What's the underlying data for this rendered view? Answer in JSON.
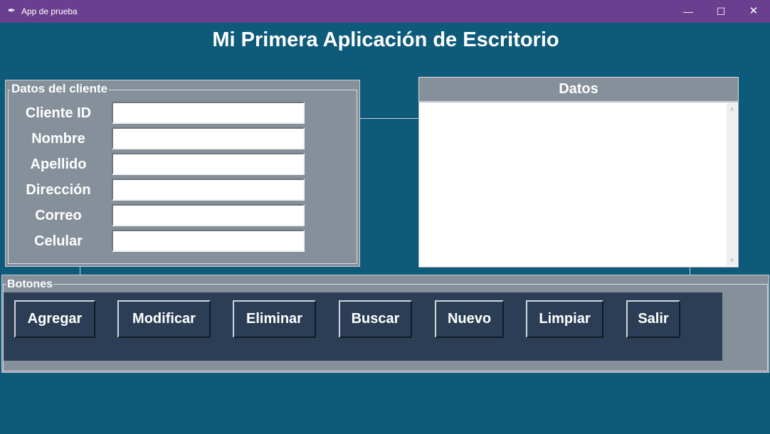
{
  "window": {
    "title": "App de prueba",
    "icon": "feather-icon",
    "controls": {
      "minimize": "—",
      "maximize": "☐",
      "close": "✕"
    }
  },
  "app": {
    "heading": "Mi Primera Aplicación de Escritorio",
    "cliente": {
      "legend": "Datos del cliente",
      "fields": [
        {
          "label": "Cliente ID",
          "value": ""
        },
        {
          "label": "Nombre",
          "value": ""
        },
        {
          "label": "Apellido",
          "value": ""
        },
        {
          "label": "Dirección",
          "value": ""
        },
        {
          "label": "Correo",
          "value": ""
        },
        {
          "label": "Celular",
          "value": ""
        }
      ]
    },
    "datos": {
      "title": "Datos",
      "content": ""
    },
    "botones": {
      "legend": "Botones",
      "buttons": [
        "Agregar",
        "Modificar",
        "Eliminar",
        "Buscar",
        "Nuevo",
        "Limpiar",
        "Salir"
      ]
    }
  },
  "colors": {
    "titlebar": "#6b3f8f",
    "background": "#0e5a7a",
    "frame": "#86909b",
    "button": "#2c3e55"
  }
}
